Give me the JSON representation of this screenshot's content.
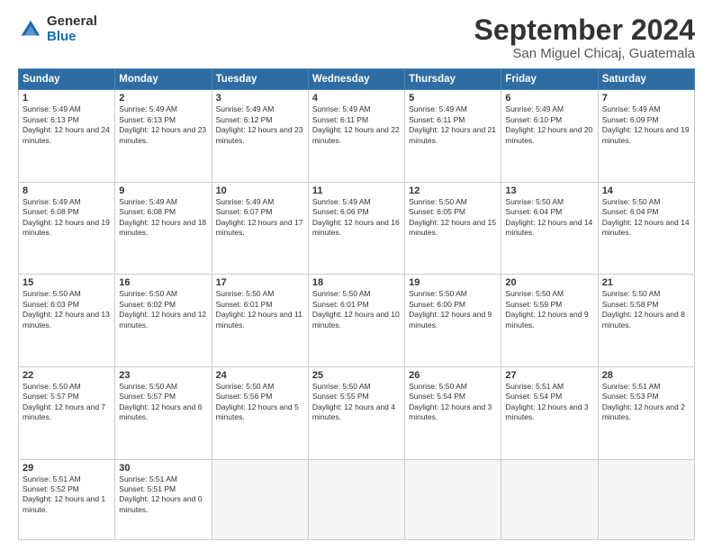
{
  "logo": {
    "general": "General",
    "blue": "Blue"
  },
  "header": {
    "month": "September 2024",
    "location": "San Miguel Chicaj, Guatemala"
  },
  "weekdays": [
    "Sunday",
    "Monday",
    "Tuesday",
    "Wednesday",
    "Thursday",
    "Friday",
    "Saturday"
  ],
  "weeks": [
    [
      {
        "day": "1",
        "sunrise": "5:49 AM",
        "sunset": "6:13 PM",
        "daylight": "12 hours and 24 minutes."
      },
      {
        "day": "2",
        "sunrise": "5:49 AM",
        "sunset": "6:13 PM",
        "daylight": "12 hours and 23 minutes."
      },
      {
        "day": "3",
        "sunrise": "5:49 AM",
        "sunset": "6:12 PM",
        "daylight": "12 hours and 23 minutes."
      },
      {
        "day": "4",
        "sunrise": "5:49 AM",
        "sunset": "6:11 PM",
        "daylight": "12 hours and 22 minutes."
      },
      {
        "day": "5",
        "sunrise": "5:49 AM",
        "sunset": "6:11 PM",
        "daylight": "12 hours and 21 minutes."
      },
      {
        "day": "6",
        "sunrise": "5:49 AM",
        "sunset": "6:10 PM",
        "daylight": "12 hours and 20 minutes."
      },
      {
        "day": "7",
        "sunrise": "5:49 AM",
        "sunset": "6:09 PM",
        "daylight": "12 hours and 19 minutes."
      }
    ],
    [
      {
        "day": "8",
        "sunrise": "5:49 AM",
        "sunset": "6:08 PM",
        "daylight": "12 hours and 19 minutes."
      },
      {
        "day": "9",
        "sunrise": "5:49 AM",
        "sunset": "6:08 PM",
        "daylight": "12 hours and 18 minutes."
      },
      {
        "day": "10",
        "sunrise": "5:49 AM",
        "sunset": "6:07 PM",
        "daylight": "12 hours and 17 minutes."
      },
      {
        "day": "11",
        "sunrise": "5:49 AM",
        "sunset": "6:06 PM",
        "daylight": "12 hours and 16 minutes."
      },
      {
        "day": "12",
        "sunrise": "5:50 AM",
        "sunset": "6:05 PM",
        "daylight": "12 hours and 15 minutes."
      },
      {
        "day": "13",
        "sunrise": "5:50 AM",
        "sunset": "6:04 PM",
        "daylight": "12 hours and 14 minutes."
      },
      {
        "day": "14",
        "sunrise": "5:50 AM",
        "sunset": "6:04 PM",
        "daylight": "12 hours and 14 minutes."
      }
    ],
    [
      {
        "day": "15",
        "sunrise": "5:50 AM",
        "sunset": "6:03 PM",
        "daylight": "12 hours and 13 minutes."
      },
      {
        "day": "16",
        "sunrise": "5:50 AM",
        "sunset": "6:02 PM",
        "daylight": "12 hours and 12 minutes."
      },
      {
        "day": "17",
        "sunrise": "5:50 AM",
        "sunset": "6:01 PM",
        "daylight": "12 hours and 11 minutes."
      },
      {
        "day": "18",
        "sunrise": "5:50 AM",
        "sunset": "6:01 PM",
        "daylight": "12 hours and 10 minutes."
      },
      {
        "day": "19",
        "sunrise": "5:50 AM",
        "sunset": "6:00 PM",
        "daylight": "12 hours and 9 minutes."
      },
      {
        "day": "20",
        "sunrise": "5:50 AM",
        "sunset": "5:59 PM",
        "daylight": "12 hours and 9 minutes."
      },
      {
        "day": "21",
        "sunrise": "5:50 AM",
        "sunset": "5:58 PM",
        "daylight": "12 hours and 8 minutes."
      }
    ],
    [
      {
        "day": "22",
        "sunrise": "5:50 AM",
        "sunset": "5:57 PM",
        "daylight": "12 hours and 7 minutes."
      },
      {
        "day": "23",
        "sunrise": "5:50 AM",
        "sunset": "5:57 PM",
        "daylight": "12 hours and 6 minutes."
      },
      {
        "day": "24",
        "sunrise": "5:50 AM",
        "sunset": "5:56 PM",
        "daylight": "12 hours and 5 minutes."
      },
      {
        "day": "25",
        "sunrise": "5:50 AM",
        "sunset": "5:55 PM",
        "daylight": "12 hours and 4 minutes."
      },
      {
        "day": "26",
        "sunrise": "5:50 AM",
        "sunset": "5:54 PM",
        "daylight": "12 hours and 3 minutes."
      },
      {
        "day": "27",
        "sunrise": "5:51 AM",
        "sunset": "5:54 PM",
        "daylight": "12 hours and 3 minutes."
      },
      {
        "day": "28",
        "sunrise": "5:51 AM",
        "sunset": "5:53 PM",
        "daylight": "12 hours and 2 minutes."
      }
    ],
    [
      {
        "day": "29",
        "sunrise": "5:51 AM",
        "sunset": "5:52 PM",
        "daylight": "12 hours and 1 minute."
      },
      {
        "day": "30",
        "sunrise": "5:51 AM",
        "sunset": "5:51 PM",
        "daylight": "12 hours and 0 minutes."
      },
      null,
      null,
      null,
      null,
      null
    ]
  ]
}
